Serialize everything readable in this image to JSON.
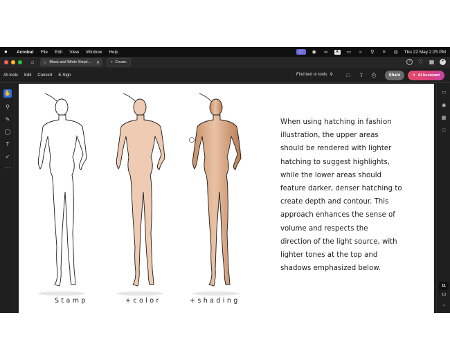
{
  "menubar": {
    "app_name": "Acrobat",
    "menus": [
      "File",
      "Edit",
      "View",
      "Window",
      "Help"
    ],
    "clock": "Thu 22 May  2:25 PM"
  },
  "tabbar": {
    "doc_tab_title": "Black and White Simpl...",
    "create_label": "Create"
  },
  "toolsbar": {
    "links": [
      "All tools",
      "Edit",
      "Convert",
      "E-Sign"
    ],
    "find_label": "Find text or tools",
    "share_label": "Share",
    "ai_label": "AI Assistant"
  },
  "pager": {
    "current_page": "11",
    "total_pages": "13"
  },
  "document": {
    "captions": [
      "Stamp",
      "+color",
      "+shading"
    ],
    "body_lines": [
      "When using hatching in fashion",
      "illustration, the upper areas",
      "should be rendered with lighter",
      "hatching to suggest highlights,",
      "while the lower areas should",
      "feature darker, denser hatching to",
      "create depth and contour. This",
      "approach enhances the sense of",
      "volume and respects the",
      "direction of the light source, with",
      "lighter tones at the top and",
      "shadows emphasized below."
    ]
  },
  "colors": {
    "skin_color": "#eecbb2",
    "skin_shaded": "#dcaa86",
    "ai_button": "#d9407a",
    "active_tool": "#2d6fe0"
  }
}
